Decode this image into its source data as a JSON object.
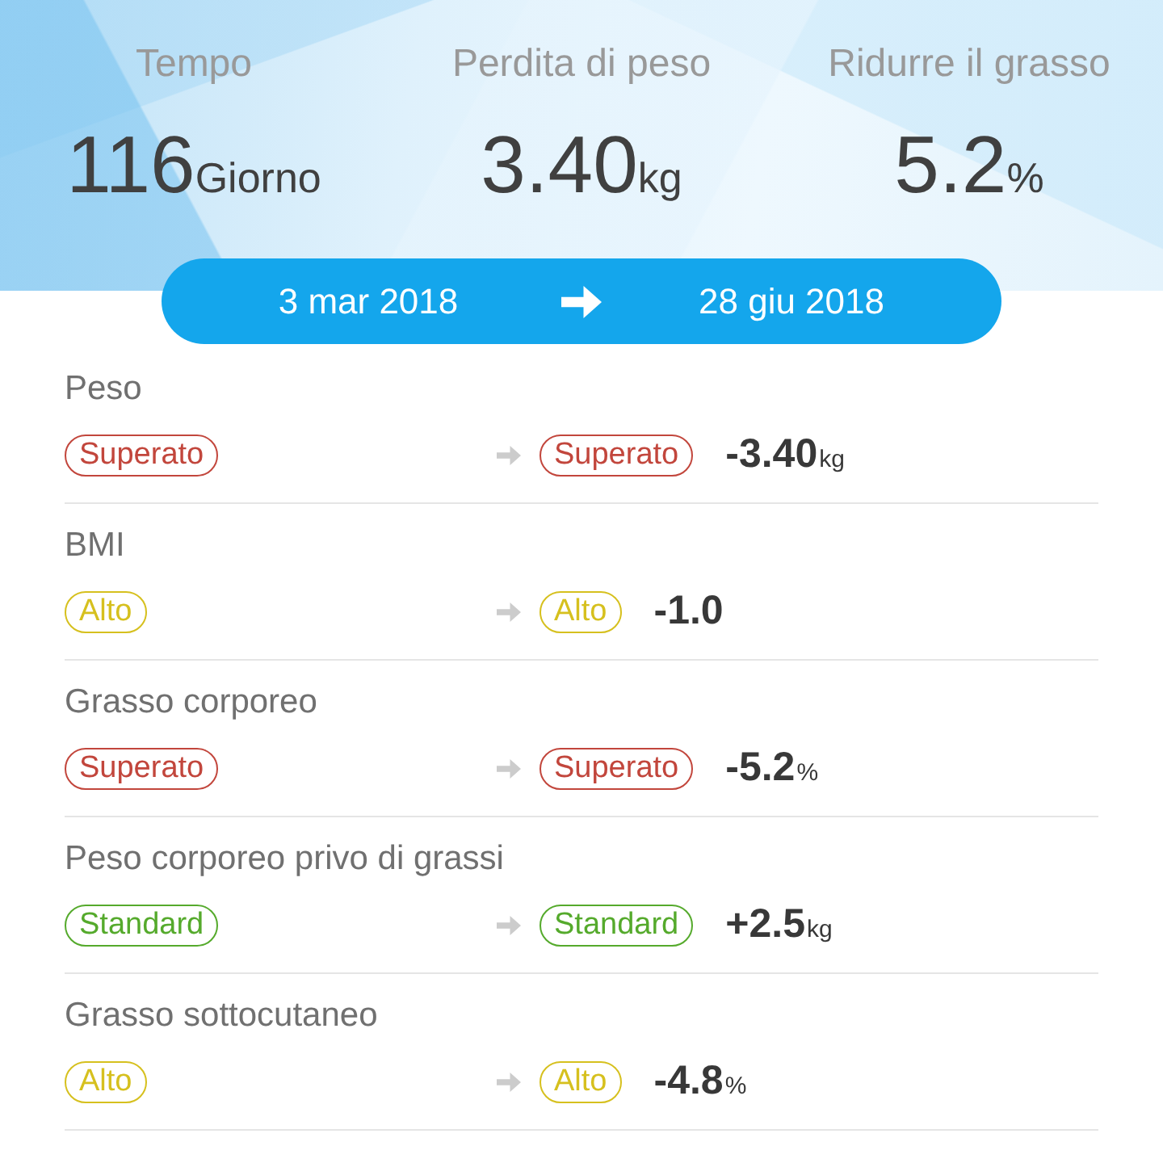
{
  "summary": {
    "stats": [
      {
        "label": "Tempo",
        "value": "116",
        "unit": "Giorno"
      },
      {
        "label": "Perdita di peso",
        "value": "3.40",
        "unit": "kg"
      },
      {
        "label": "Ridurre il grasso",
        "value": "5.2",
        "unit": "%"
      }
    ]
  },
  "date_range": {
    "start": "3 mar 2018",
    "end": "28 giu 2018"
  },
  "metrics": [
    {
      "name": "Peso",
      "before": {
        "text": "Superato",
        "color": "#c2463c"
      },
      "after": {
        "text": "Superato",
        "color": "#c2463c"
      },
      "change": "-3.40",
      "unit": "kg"
    },
    {
      "name": "BMI",
      "before": {
        "text": "Alto",
        "color": "#d6c01e"
      },
      "after": {
        "text": "Alto",
        "color": "#d6c01e"
      },
      "change": "-1.0"
    },
    {
      "name": "Grasso corporeo",
      "before": {
        "text": "Superato",
        "color": "#c2463c"
      },
      "after": {
        "text": "Superato",
        "color": "#c2463c"
      },
      "change": "-5.2",
      "unit": "%"
    },
    {
      "name": "Peso corporeo privo di grassi",
      "before": {
        "text": "Standard",
        "color": "#55aa2c"
      },
      "after": {
        "text": "Standard",
        "color": "#55aa2c"
      },
      "change": "+2.5",
      "unit": "kg"
    },
    {
      "name": "Grasso sottocutaneo",
      "before": {
        "text": "Alto",
        "color": "#d6c01e"
      },
      "after": {
        "text": "Alto",
        "color": "#d6c01e"
      },
      "change": "-4.8",
      "unit": "%"
    }
  ]
}
